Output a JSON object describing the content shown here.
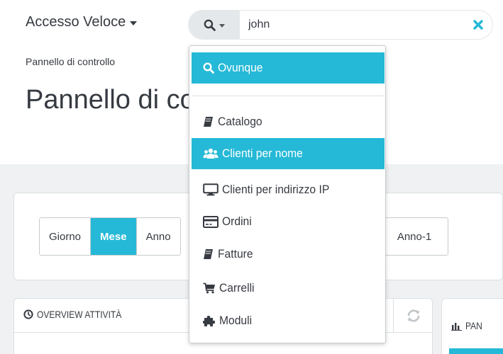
{
  "header": {
    "quick_access_label": "Accesso Veloce",
    "search_value": "john",
    "breadcrumb": "Pannello di controllo",
    "page_title": "Pannello di controllo"
  },
  "period_filter": {
    "buttons": [
      "Giorno",
      "Mese",
      "Anno"
    ],
    "active": "Mese",
    "extra_button": "Anno-1"
  },
  "overview": {
    "title": "Overview attività"
  },
  "side_panel": {
    "title": "PAN"
  },
  "search_dropdown": {
    "items": [
      {
        "label": "Ovunque",
        "icon": "search-icon",
        "highlighted": true
      },
      {
        "label": "Catalogo",
        "icon": "book-icon",
        "highlighted": false
      },
      {
        "label": "Clienti per nome",
        "icon": "users-icon",
        "highlighted": true
      },
      {
        "label": "Clienti per indirizzo IP",
        "icon": "desktop-icon",
        "highlighted": false
      },
      {
        "label": "Ordini",
        "icon": "credit-card-icon",
        "highlighted": false
      },
      {
        "label": "Fatture",
        "icon": "book-icon",
        "highlighted": false
      },
      {
        "label": "Carrelli",
        "icon": "shopping-cart-icon",
        "highlighted": false
      },
      {
        "label": "Moduli",
        "icon": "puzzle-piece-icon",
        "highlighted": false
      }
    ]
  },
  "colors": {
    "accent": "#25b9d7",
    "text": "#363a41",
    "background": "#eff1f2"
  }
}
